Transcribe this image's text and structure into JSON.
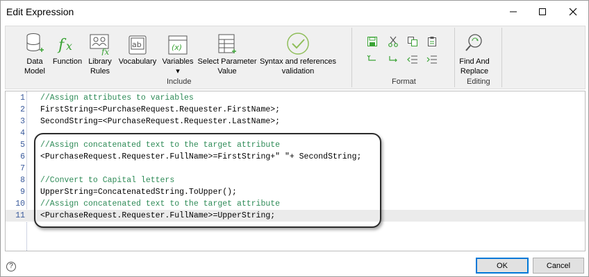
{
  "window": {
    "title": "Edit Expression"
  },
  "ribbon": {
    "include_group": {
      "label": "Include",
      "buttons": [
        {
          "label": "Data\nModel",
          "icon": "data-model-icon"
        },
        {
          "label": "Function",
          "icon": "function-icon"
        },
        {
          "label": "Library\nRules",
          "icon": "library-rules-icon"
        },
        {
          "label": "Vocabulary",
          "icon": "vocabulary-icon"
        },
        {
          "label": "Variables\n▾",
          "icon": "variables-icon"
        },
        {
          "label": "Select Parameter\nValue",
          "icon": "select-parameter-icon"
        },
        {
          "label": "Syntax and references\nvalidation",
          "icon": "validation-check-icon"
        }
      ]
    },
    "format_group": {
      "label": "Format",
      "buttons": [
        "save-icon",
        "cut-icon",
        "copy-icon",
        "paste-icon",
        "undo-icon",
        "redo-icon",
        "outdent-icon",
        "indent-icon"
      ]
    },
    "editing_group": {
      "label": "Editing",
      "find_replace_label": "Find And\nReplace"
    }
  },
  "editor": {
    "lines": [
      {
        "n": "1",
        "text": "//Assign attributes to variables",
        "comment": true
      },
      {
        "n": "2",
        "text": "FirstString=<PurchaseRequest.Requester.FirstName>;",
        "comment": false
      },
      {
        "n": "3",
        "text": "SecondString=<PurchaseRequest.Requester.LastName>;",
        "comment": false
      },
      {
        "n": "4",
        "text": "",
        "comment": false
      },
      {
        "n": "5",
        "text": "//Assign concatenated text to the target attribute",
        "comment": true
      },
      {
        "n": "6",
        "text": "<PurchaseRequest.Requester.FullName>=FirstString+\" \"+ SecondString;",
        "comment": false
      },
      {
        "n": "7",
        "text": "",
        "comment": false
      },
      {
        "n": "8",
        "text": "//Convert to Capital letters",
        "comment": true
      },
      {
        "n": "9",
        "text": "UpperString=ConcatenatedString.ToUpper();",
        "comment": false
      },
      {
        "n": "10",
        "text": "//Assign concatenated text to the target attribute",
        "comment": true
      },
      {
        "n": "11",
        "text": "<PurchaseRequest.Requester.FullName>=UpperString;",
        "comment": false
      }
    ]
  },
  "footer": {
    "help": "?",
    "ok_label": "OK",
    "cancel_label": "Cancel"
  },
  "colors": {
    "comment": "#2e8b57",
    "line_number": "#3a5a9c",
    "accent": "#0078d7",
    "validation_icon": "#8fbe5a",
    "format_icon": "#3aa335"
  }
}
